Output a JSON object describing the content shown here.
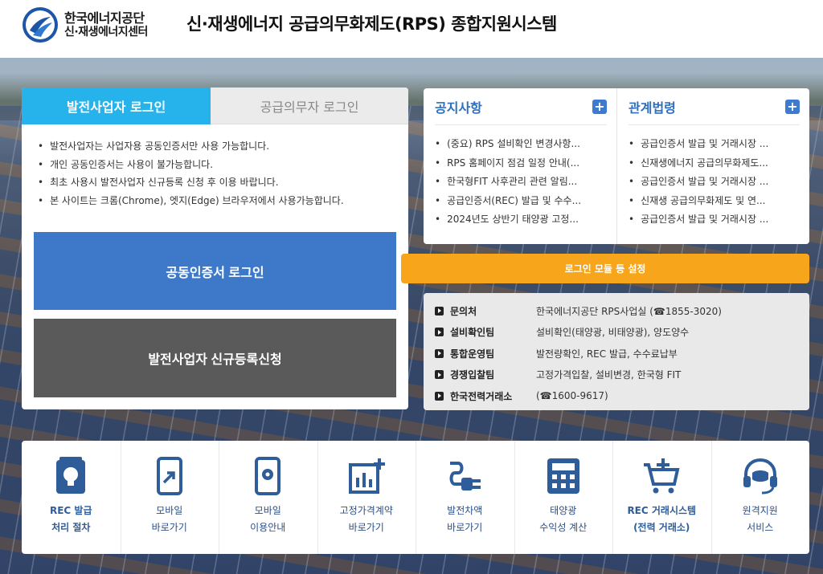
{
  "header": {
    "org_name": "한국에너지공단",
    "center_name": "신·재생에너지센터",
    "site_title": "신·재생에너지 공급의무화제도(RPS) 종합지원시스템"
  },
  "login": {
    "tabs": [
      {
        "label": "발전사업자 로그인",
        "active": true
      },
      {
        "label": "공급의무자 로그인",
        "active": false
      }
    ],
    "notices": [
      "발전사업자는 사업자용 공동인증서만 사용 가능합니다.",
      "개인 공동인증서는 사용이 불가능합니다.",
      "최초 사용시 발전사업자 신규등록 신청 후 이용 바랍니다.",
      "본 사이트는 크롬(Chrome), 엣지(Edge) 브라우저에서 사용가능합니다."
    ],
    "cert_button": "공동인증서 로그인",
    "register_button": "발전사업자 신규등록신청"
  },
  "boards": {
    "notice": {
      "title": "공지사항",
      "items": [
        "(중요) RPS 설비확인 변경사항...",
        "RPS 홈페이지 점검 일정 안내(...",
        "한국형FIT 사후관리 관련 알림...",
        "공급인증서(REC) 발급 및 수수...",
        "2024년도 상반기 태양광 고정..."
      ]
    },
    "law": {
      "title": "관계법령",
      "items": [
        "공급인증서 발급 및 거래시장 ...",
        "신재생에너지 공급의무화제도...",
        "공급인증서 발급 및 거래시장 ...",
        "신재생 공급의무화제도 및 연...",
        "공급인증서 발급 및 거래시장 ..."
      ]
    }
  },
  "orange_bar": "로그인 모듈 등 설정",
  "contacts": [
    {
      "label": "문의처",
      "value": "한국에너지공단 RPS사업실 (☎1855-3020)"
    },
    {
      "label": "설비확인팀",
      "value": "설비확인(태양광, 비태양광), 양도양수"
    },
    {
      "label": "통합운영팀",
      "value": "발전량확인, REC 발급, 수수료납부"
    },
    {
      "label": "경쟁입찰팀",
      "value": "고정가격입찰, 설비변경, 한국형 FIT"
    },
    {
      "label": "한국전력거래소",
      "value": "(☎1600-9617)"
    }
  ],
  "shortcuts": [
    {
      "label": "REC 발급\n처리 절차",
      "icon": "bulb-doc-icon",
      "bold": true
    },
    {
      "label": "모바일\n바로가기",
      "icon": "mobile-link-icon",
      "bold": false
    },
    {
      "label": "모바일\n이용안내",
      "icon": "mobile-gear-icon",
      "bold": false
    },
    {
      "label": "고정가격계약\n바로가기",
      "icon": "chart-plus-icon",
      "bold": false
    },
    {
      "label": "발전차액\n바로가기",
      "icon": "plug-icon",
      "bold": false
    },
    {
      "label": "태양광\n수익성 계산",
      "icon": "calculator-icon",
      "bold": false
    },
    {
      "label": "REC 거래시스템\n(전력 거래소)",
      "icon": "cart-icon",
      "bold": true
    },
    {
      "label": "원격지원\n서비스",
      "icon": "headset-icon",
      "bold": false
    }
  ],
  "colors": {
    "tab_active": "#26b3ec",
    "cert_button": "#3e79c9",
    "register_button": "#5a5a5a",
    "orange_bar": "#f7a51b",
    "board_title": "#2f6fbd"
  }
}
